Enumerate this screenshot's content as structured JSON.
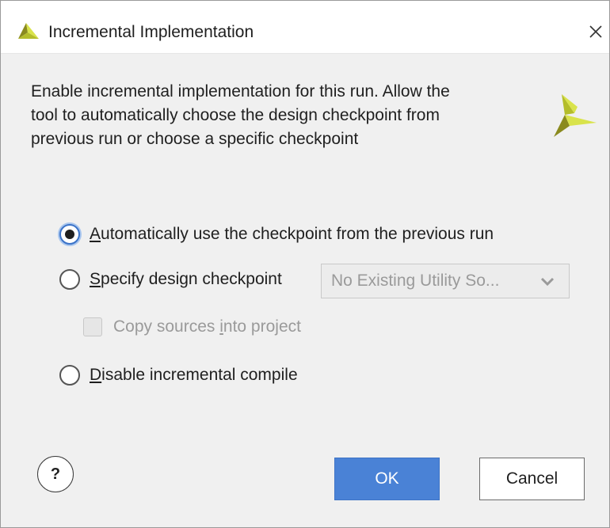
{
  "window": {
    "title": "Incremental Implementation",
    "logo_icon": "vivado-logo-icon",
    "close_icon": "close-icon"
  },
  "description": {
    "lines": [
      "Enable incremental implementation for this run. Allow the",
      "tool to automatically choose the design checkpoint from",
      "previous run or choose a specific checkpoint"
    ],
    "brand_icon": "xilinx-logo-icon"
  },
  "options": {
    "auto": {
      "mnemonic": "A",
      "rest": "utomatically use the checkpoint from the previous run",
      "checked": true
    },
    "specify": {
      "mnemonic": "S",
      "rest": "pecify design checkpoint",
      "checked": false,
      "combo_value": "No Existing Utility So...",
      "combo_icon": "chevron-down-icon",
      "combo_enabled": false
    },
    "copy_sources": {
      "before": "Copy sources ",
      "mnemonic": "i",
      "after": "nto project",
      "checked": false,
      "enabled": false
    },
    "disable": {
      "mnemonic": "D",
      "rest": "isable incremental compile",
      "checked": false
    }
  },
  "footer": {
    "help_label": "?",
    "ok_label": "OK",
    "cancel_label": "Cancel"
  },
  "colors": {
    "accent": "#4a82d6",
    "logo_dark": "#8a8a1e",
    "logo_light": "#d9e34b",
    "logo_mid": "#b4bd2a"
  }
}
